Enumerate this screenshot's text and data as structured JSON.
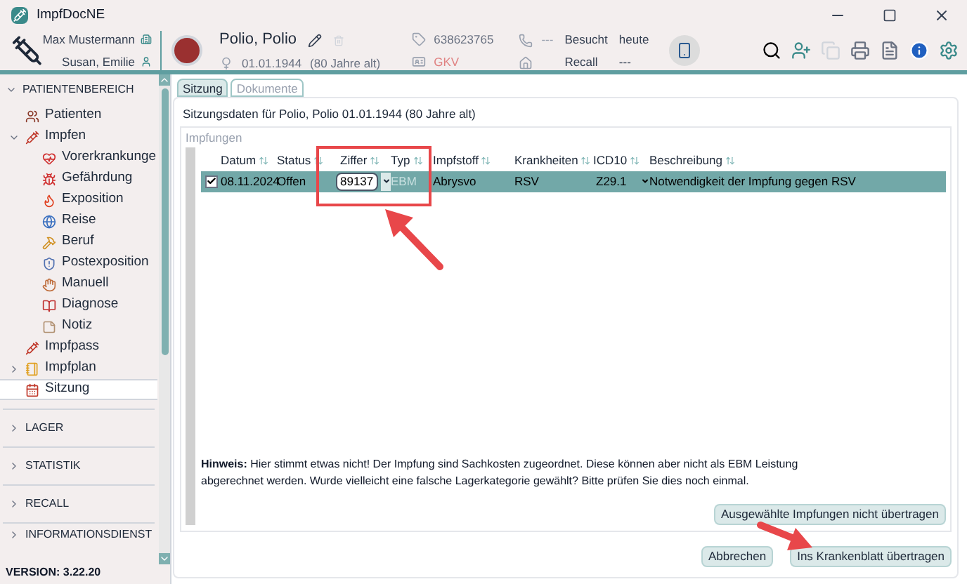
{
  "window": {
    "title": "ImpfDocNE"
  },
  "header": {
    "user": "Max Mustermann",
    "practice_user": "Susan, Emilie",
    "patient_name": "Polio, Polio",
    "birth_date": "01.01.1944",
    "age": "(80 Jahre alt)",
    "insurance_number": "638623765",
    "insurance_type": "GKV",
    "phone": "---",
    "visited_label": "Besucht",
    "visited_value": "heute",
    "recall_label": "Recall",
    "recall_value": "---"
  },
  "sidebar": {
    "sections": [
      {
        "label": "PATIENTENBEREICH",
        "expanded": true,
        "items": [
          {
            "label": "Patienten",
            "selected": false
          },
          {
            "label": "Impfen",
            "selected": false,
            "expanded": true,
            "children": [
              {
                "label": "Vorerkrankunge",
                "selected": false
              },
              {
                "label": "Gefährdung",
                "selected": false
              },
              {
                "label": "Exposition",
                "selected": false
              },
              {
                "label": "Reise",
                "selected": false
              },
              {
                "label": "Beruf",
                "selected": false
              },
              {
                "label": "Postexposition",
                "selected": false
              },
              {
                "label": "Manuell",
                "selected": false
              },
              {
                "label": "Diagnose",
                "selected": false
              },
              {
                "label": "Notiz",
                "selected": false
              }
            ]
          },
          {
            "label": "Impfpass",
            "selected": false
          },
          {
            "label": "Impfplan",
            "selected": false,
            "expanded": false
          },
          {
            "label": "Sitzung",
            "selected": true
          }
        ]
      },
      {
        "label": "LAGER",
        "expanded": false
      },
      {
        "label": "STATISTIK",
        "expanded": false
      },
      {
        "label": "RECALL",
        "expanded": false
      },
      {
        "label": "INFORMATIONSDIENST",
        "expanded": false
      }
    ],
    "version": "VERSION: 3.22.20"
  },
  "tabs": [
    {
      "label": "Sitzung",
      "selected": true
    },
    {
      "label": "Dokumente",
      "selected": false
    }
  ],
  "session_title": "Sitzungsdaten für Polio, Polio 01.01.1944 (80 Jahre alt)",
  "group_title": "Impfungen",
  "table": {
    "columns": [
      "Datum",
      "Status",
      "Ziffer",
      "Typ",
      "Impfstoff",
      "Krankheiten",
      "ICD10",
      "Beschreibung"
    ],
    "rows": [
      {
        "checked": true,
        "selected": true,
        "date": "08.11.2024",
        "status": "Offen",
        "code": "89137",
        "type": "EBM",
        "vaccine": "Abrysvo",
        "diseases": "RSV",
        "icd10": "Z29.1",
        "description": "Notwendigkeit der Impfung gegen RSV"
      }
    ]
  },
  "hint": "**Hinweis:** Hier stimmt etwas nicht! Der Impfung sind Sachkosten zugeordnet. Diese können aber nicht als EBM Leistung abgerechnet werden. Wurde vielleicht eine falsche Lagerkategorie gewählt? Bitte prüfen Sie dies noch einmal.",
  "buttons": {
    "exclude": "Ausgewählte Impfungen nicht übertragen",
    "cancel": "Abbrechen",
    "transfer": "Ins Krankenblatt übertragen"
  }
}
